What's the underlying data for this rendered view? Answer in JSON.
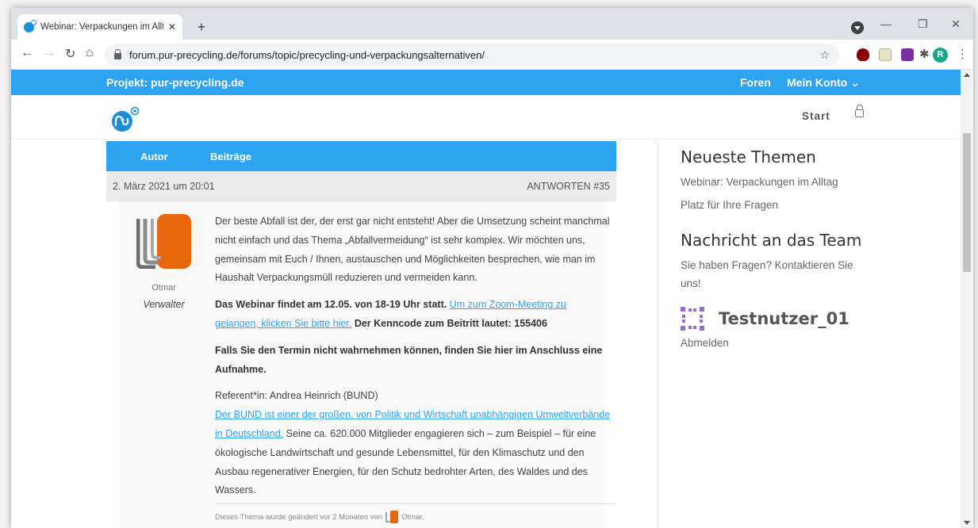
{
  "browser": {
    "tab_title": "Webinar: Verpackungen im Alltag",
    "tab_close": "✕",
    "new_tab": "+",
    "url": "forum.pur-precycling.de/forums/topic/precycling-und-verpackungsalternativen/",
    "avatar_letter": "R",
    "win_min": "—",
    "win_max": "❐",
    "win_close": "✕"
  },
  "site": {
    "project_label": "Projekt: pur-precycling.de",
    "nav_foren": "Foren",
    "nav_konto": "Mein Konto ⌄",
    "nav_start": "Start"
  },
  "forum": {
    "col_author": "Autor",
    "col_posts": "Beiträge",
    "post_date": "2. März 2021 um 20:01",
    "post_reply": "ANTWORTEN   #35",
    "author_name": "Otmar",
    "author_role": "Verwalter",
    "p1": "Der beste Abfall ist der, der erst gar nicht entsteht! Aber die Umsetzung scheint manchmal nicht einfach und das Thema „Abfallvermeidung“ ist sehr komplex. Wir möchten uns, gemeinsam mit Euch / Ihnen, austauschen und Möglichkeiten besprechen, wie man im Haushalt Verpackungsmüll reduzieren und vermeiden kann.",
    "p2_bold": "Das Webinar findet am 12.05. von 18-19 Uhr statt.",
    "p2_link": "Um zum Zoom-Meeting zu gelangen, klicken Sie bitte hier.",
    "p2_bold2": "Der Kenncode zum Beitritt lautet: 155406",
    "p3_bold": "Falls Sie den Termin nicht wahrnehmen können, finden Sie hier im Anschluss eine Aufnahme.",
    "p4_ref": "Referent*in: Andrea Heinrich (BUND)",
    "p4_link": "Der BUND ist einer der großen, von Politik und Wirtschaft unabhängigen Umweltverbände in Deutschland.",
    "p4_rest": " Seine ca. 620.000 Mitglieder engagieren sich – zum Beispiel – für eine ökologische Landwirtschaft und gesunde Lebensmittel, für den Klimaschutz und den Ausbau regenerativer Energien, für den Schutz bedrohter Arten, des Waldes und des Wassers.",
    "changed_text": "Dieses Thema wurde geändert vor 2 Monaten von",
    "changed_user": "Otmar."
  },
  "sidebar": {
    "latest_title": "Neueste Themen",
    "latest_1": "Webinar: Verpackungen im Alltag",
    "latest_2": "Platz für Ihre Fragen",
    "msg_title": "Nachricht an das Team",
    "msg_text": "Sie haben Fragen? Kontaktieren Sie uns!",
    "username": "Testnutzer_01",
    "logout": "Abmelden"
  },
  "colors": {
    "accent": "#2ea3f2",
    "avatar_orange": "#e8670c",
    "identicon": "#9a6ad6"
  }
}
